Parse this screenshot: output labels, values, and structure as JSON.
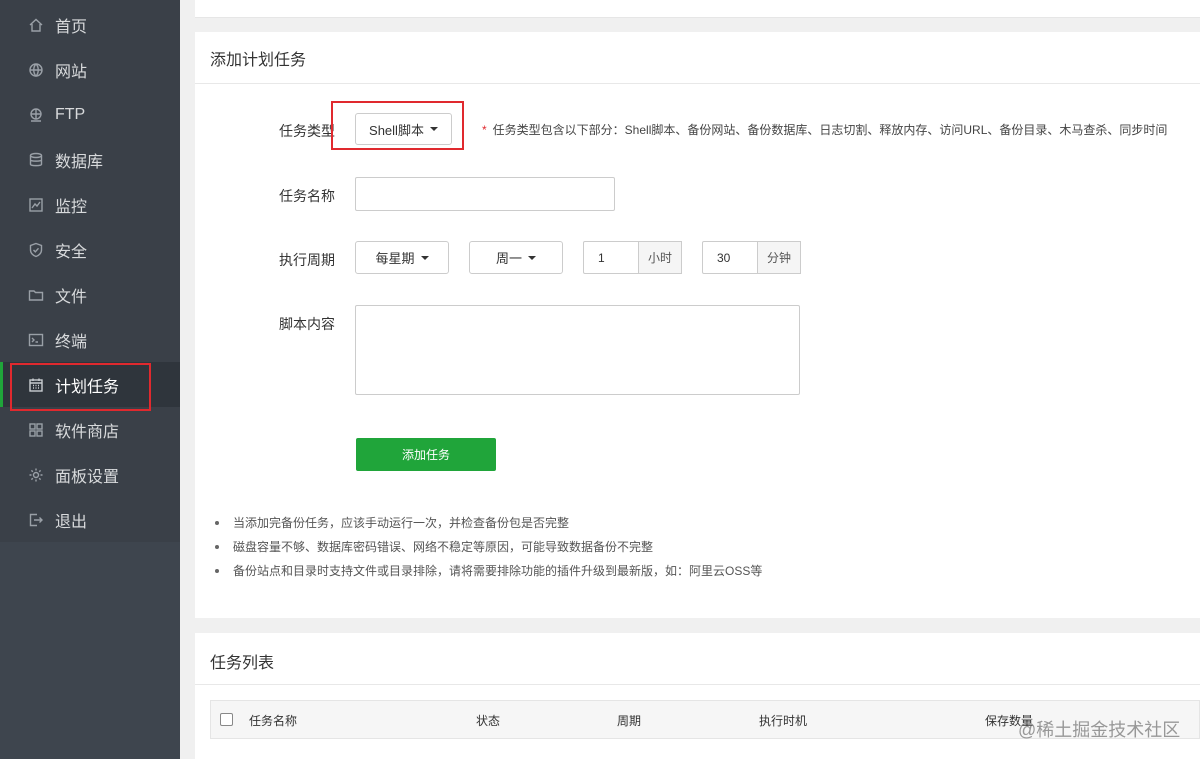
{
  "sidebar": {
    "items": [
      {
        "label": "首页",
        "icon": "home-icon"
      },
      {
        "label": "网站",
        "icon": "globe-icon"
      },
      {
        "label": "FTP",
        "icon": "ftp-globe-icon"
      },
      {
        "label": "数据库",
        "icon": "database-icon"
      },
      {
        "label": "监控",
        "icon": "monitor-chart-icon"
      },
      {
        "label": "安全",
        "icon": "shield-check-icon"
      },
      {
        "label": "文件",
        "icon": "folder-icon"
      },
      {
        "label": "终端",
        "icon": "terminal-icon"
      },
      {
        "label": "计划任务",
        "icon": "calendar-icon",
        "active": true
      },
      {
        "label": "软件商店",
        "icon": "grid-apps-icon"
      },
      {
        "label": "面板设置",
        "icon": "gear-icon"
      },
      {
        "label": "退出",
        "icon": "logout-icon"
      }
    ]
  },
  "add_task": {
    "title": "添加计划任务",
    "type_label": "任务类型",
    "type_value": "Shell脚本",
    "type_hint_star": "*",
    "type_hint": "任务类型包含以下部分：Shell脚本、备份网站、备份数据库、日志切割、释放内存、访问URL、备份目录、木马查杀、同步时间",
    "name_label": "任务名称",
    "name_value": "",
    "cycle_label": "执行周期",
    "cycle_type": "每星期",
    "cycle_day": "周一",
    "hour_value": "1",
    "hour_unit": "小时",
    "minute_value": "30",
    "minute_unit": "分钟",
    "script_label": "脚本内容",
    "submit_label": "添加任务"
  },
  "tips": [
    "当添加完备份任务，应该手动运行一次，并检查备份包是否完整",
    "磁盘容量不够、数据库密码错误、网络不稳定等原因，可能导致数据备份不完整",
    "备份站点和目录时支持文件或目录排除，请将需要排除功能的插件升级到最新版，如：阿里云OSS等"
  ],
  "task_list": {
    "title": "任务列表",
    "columns": [
      "任务名称",
      "状态",
      "周期",
      "执行时机",
      "保存数量"
    ]
  },
  "watermark": "@稀土掘金技术社区",
  "colors": {
    "accent": "#20a53a",
    "highlight": "#e0292e",
    "sidebar": "#3a4048"
  }
}
